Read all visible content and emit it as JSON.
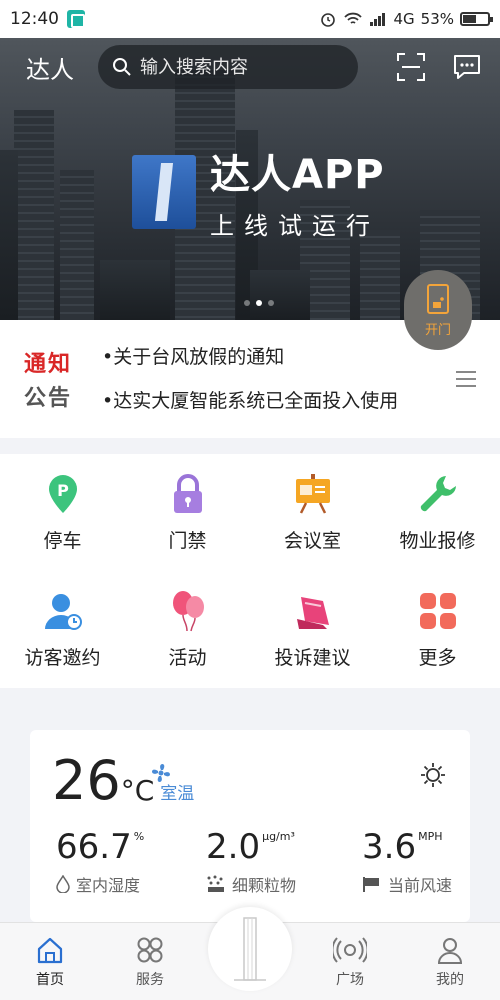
{
  "status_bar": {
    "time": "12:40",
    "network": "4G",
    "battery": "53%",
    "battery_level": 0.53
  },
  "header": {
    "city": "达人",
    "search_placeholder": "输入搜索内容"
  },
  "banner": {
    "title": "达人APP",
    "subtitle": "上线试运行",
    "slide_count": 3,
    "active_slide": 1
  },
  "open_door": {
    "label": "开门"
  },
  "notice": {
    "badge_top": "通知",
    "badge_bottom": "公告",
    "items": [
      "•关于台风放假的通知",
      "•达实大厦智能系统已全面投入使用"
    ]
  },
  "services": [
    {
      "label": "停车",
      "icon": "parking-icon"
    },
    {
      "label": "门禁",
      "icon": "lock-icon"
    },
    {
      "label": "会议室",
      "icon": "meeting-room-icon"
    },
    {
      "label": "物业报修",
      "icon": "wrench-icon"
    },
    {
      "label": "访客邀约",
      "icon": "visitor-icon"
    },
    {
      "label": "活动",
      "icon": "balloon-icon"
    },
    {
      "label": "投诉建议",
      "icon": "complaint-icon"
    },
    {
      "label": "更多",
      "icon": "more-icon"
    }
  ],
  "environment": {
    "room_temp": {
      "value": "26",
      "unit": "°C",
      "label": "室温"
    },
    "humidity": {
      "value": "66.7",
      "unit": "%",
      "label": "室内湿度"
    },
    "pm25": {
      "value": "2.0",
      "unit": "μg/m³",
      "label": "细颗粒物"
    },
    "wind": {
      "value": "3.6",
      "unit": "MPH",
      "label": "当前风速"
    }
  },
  "bottom_nav": [
    {
      "label": "首页",
      "icon": "home-icon",
      "active": true
    },
    {
      "label": "服务",
      "icon": "services-icon",
      "active": false
    },
    {
      "label": "广场",
      "icon": "plaza-icon",
      "active": false
    },
    {
      "label": "我的",
      "icon": "profile-icon",
      "active": false
    }
  ],
  "colors": {
    "accent_blue": "#4a8bd6",
    "notice_red": "#d92727",
    "door_orange": "#f3a43a"
  }
}
